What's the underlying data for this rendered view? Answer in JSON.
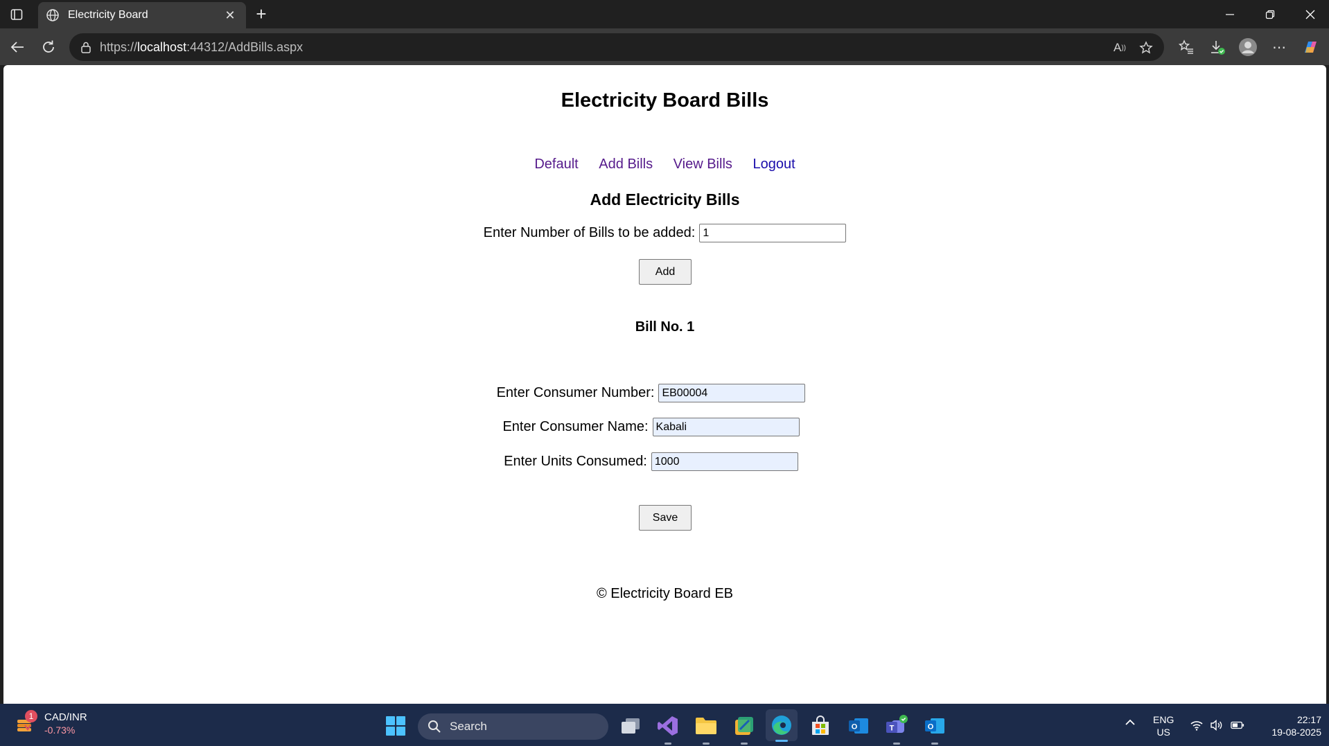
{
  "browser": {
    "tab_title": "Electricity Board",
    "url_scheme": "https://",
    "url_host": "localhost",
    "url_rest": ":44312/AddBills.aspx"
  },
  "page": {
    "title": "Electricity Board Bills",
    "nav": [
      "Default",
      "Add Bills",
      "View Bills",
      "Logout"
    ],
    "section_title": "Add Electricity Bills",
    "bill_count_label": "Enter Number of Bills to be added:",
    "bill_count_value": "1",
    "add_button": "Add",
    "bill_heading": "Bill No. 1",
    "consumer_number_label": "Enter Consumer Number:",
    "consumer_number_value": "EB00004",
    "consumer_name_label": "Enter Consumer Name:",
    "consumer_name_value": "Kabali",
    "units_label": "Enter Units Consumed:",
    "units_value": "1000",
    "save_button": "Save",
    "footer": "© Electricity Board EB"
  },
  "taskbar": {
    "widget_badge": "1",
    "widget_title": "CAD/INR",
    "widget_change": "-0.73%",
    "search_label": "Search",
    "lang_line1": "ENG",
    "lang_line2": "US",
    "time": "22:17",
    "date": "19-08-2025"
  },
  "colors": {
    "visited_link": "#551a8b",
    "link": "#1a0dab",
    "autofill_bg": "#e8f0fe",
    "taskbar": "#1c2b4a"
  }
}
